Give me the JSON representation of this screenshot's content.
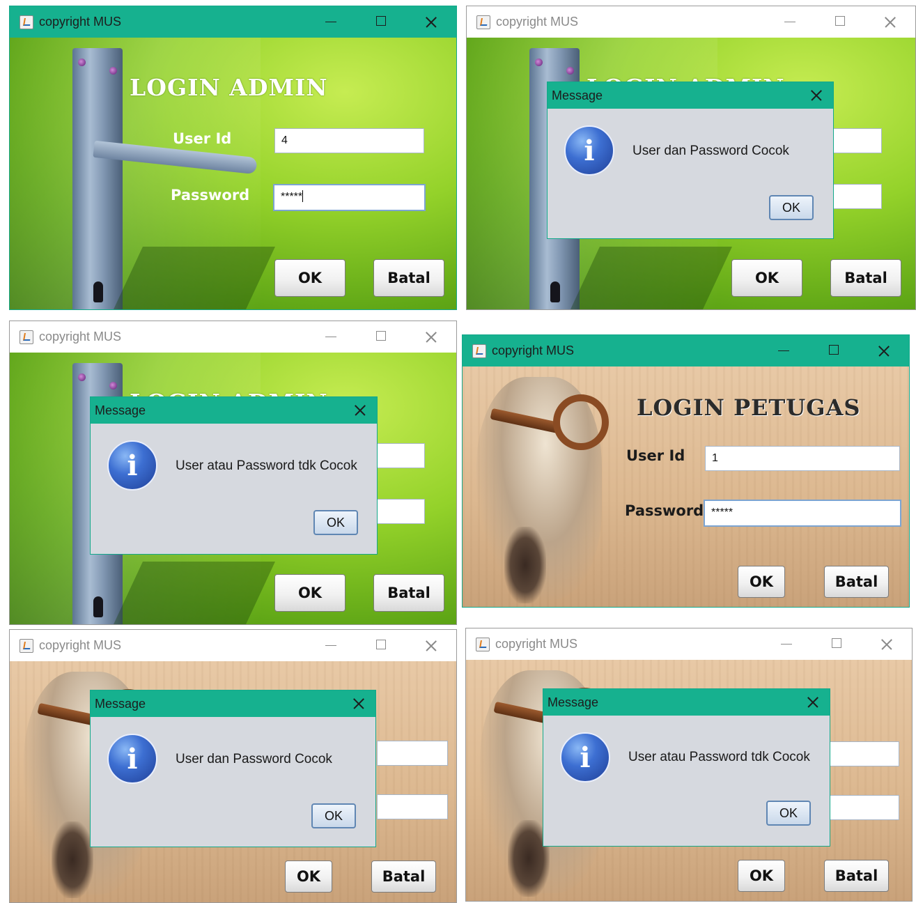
{
  "window_title": "copyright MUS",
  "admin": {
    "heading": "LOGIN ADMIN",
    "user_label": "User Id",
    "password_label": "Password",
    "user_value": "4",
    "password_value": "*****",
    "ok_label": "OK",
    "cancel_label": "Batal"
  },
  "petugas": {
    "heading": "LOGIN PETUGAS",
    "user_label": "User Id",
    "password_label": "Password",
    "user_value": "1",
    "password_value": "*****",
    "ok_label": "OK",
    "cancel_label": "Batal"
  },
  "dialog": {
    "title": "Message",
    "ok_label": "OK",
    "msg_match": "User dan Password Cocok",
    "msg_mismatch": "User atau Password tdk Cocok"
  },
  "colors": {
    "accent": "#16b18f",
    "dialog_bg": "#d6d9df"
  }
}
